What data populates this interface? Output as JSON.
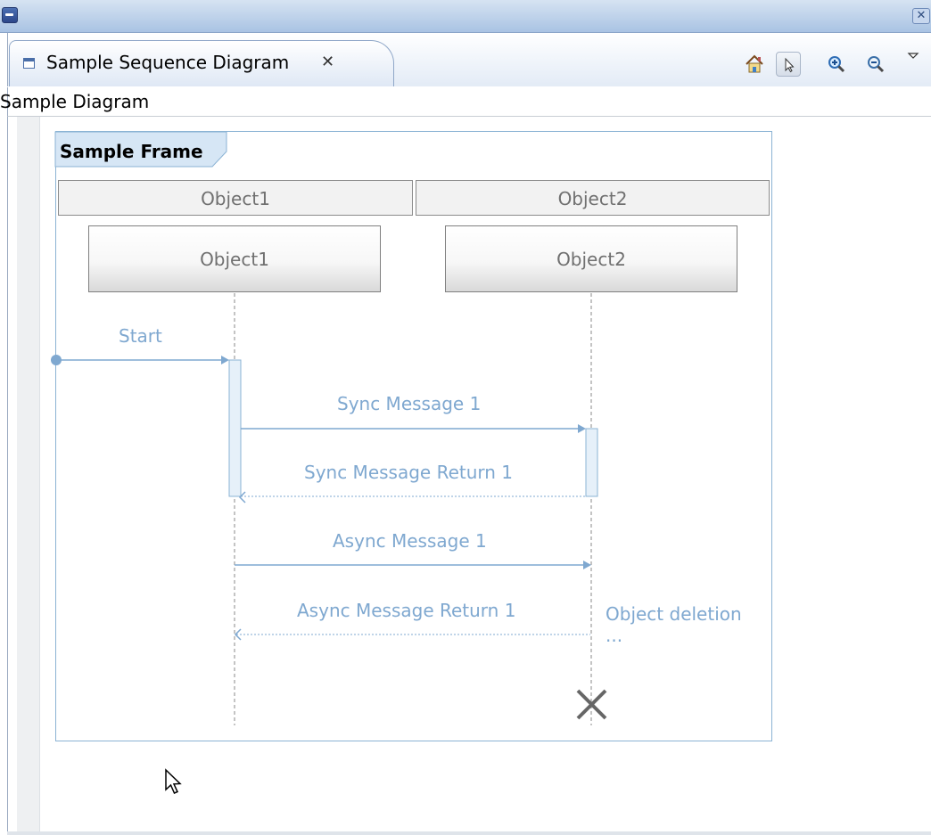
{
  "window": {
    "close_glyph": "✕"
  },
  "editor": {
    "tab_label": "Sample Sequence Diagram",
    "tab_close_glyph": "✕",
    "toolbar": [
      "home-icon",
      "select-pointer-icon",
      "zoom-in-icon",
      "zoom-out-icon",
      "view-menu-icon"
    ]
  },
  "breadcrumb": {
    "label": "Sample Diagram"
  },
  "diagram": {
    "frame_title": "Sample Frame",
    "objects": [
      {
        "header": "Object1",
        "name": "Object1"
      },
      {
        "header": "Object2",
        "name": "Object2"
      }
    ],
    "messages": [
      {
        "label": "Start",
        "kind": "found"
      },
      {
        "label": "Sync Message 1",
        "kind": "sync"
      },
      {
        "label": "Sync Message Return 1",
        "kind": "sync-return"
      },
      {
        "label": "Async Message 1",
        "kind": "async"
      },
      {
        "label": "Async Message Return 1",
        "kind": "async-return"
      }
    ],
    "deletion_label": "Object deletion",
    "deletion_ellipsis": "...",
    "colors": {
      "message": "#7fa8d0",
      "lifeline": "#8a8a8a",
      "frame": "#8bb3d4",
      "deletion": "#666666"
    }
  }
}
